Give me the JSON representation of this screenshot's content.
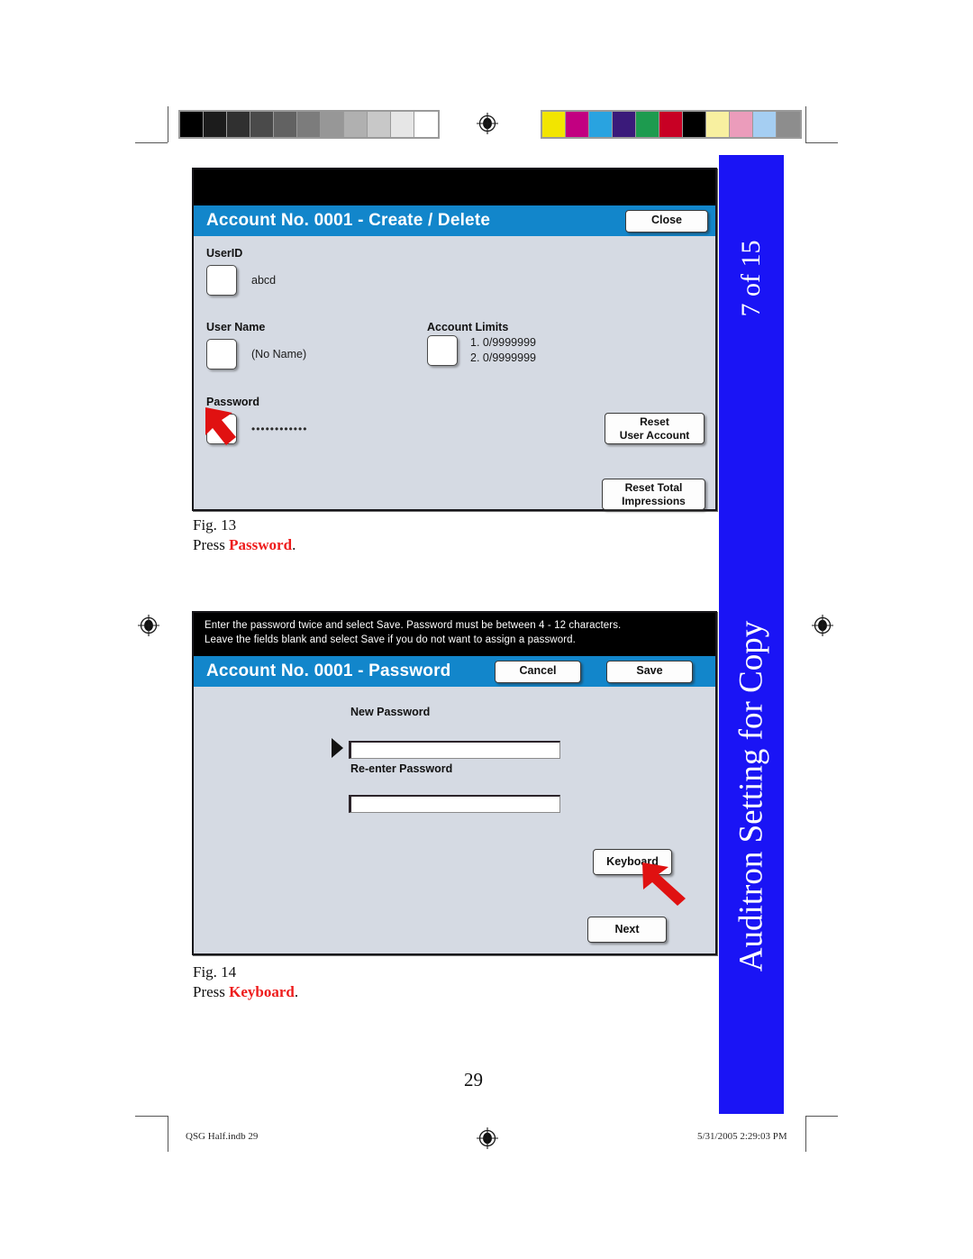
{
  "document": {
    "page_number": "29",
    "footer_left": "QSG Half.indb   29",
    "footer_right": "5/31/2005   2:29:03 PM"
  },
  "side_tab": {
    "page_indicator": "7 of 15",
    "section_title": "Auditron Setting for Copy",
    "color": "#1a14f5"
  },
  "calibration": {
    "grayscale": [
      "#000000",
      "#1c1c1c",
      "#303030",
      "#4a4a4a",
      "#626262",
      "#7c7c7c",
      "#979797",
      "#b0b0b0",
      "#c8c8c8",
      "#e6e6e6",
      "#ffffff"
    ],
    "colorbar": [
      "#f2e500",
      "#c20081",
      "#29a3e0",
      "#3a1a7a",
      "#1d9b4f",
      "#c80024",
      "#000000",
      "#f8f0a0",
      "#eb9cbb",
      "#a5cef2",
      "#8d8d8d"
    ]
  },
  "figure13": {
    "caption_line1": "Fig. 13",
    "caption_prefix": "Press ",
    "caption_highlight": "Password",
    "caption_suffix": ".",
    "panel": {
      "title": "Account No. 0001 - Create / Delete",
      "close_button": "Close",
      "userid_label": "UserID",
      "userid_value": "abcd",
      "username_label": "User Name",
      "username_value": "(No Name)",
      "account_limits_label": "Account Limits",
      "account_limits_line1": "1. 0/9999999",
      "account_limits_line2": "2. 0/9999999",
      "password_label": "Password",
      "password_value": "••••••••••••",
      "reset_user_account_button": "Reset\nUser Account",
      "reset_total_impressions_button": "Reset Total\nImpressions"
    }
  },
  "figure14": {
    "caption_line1": "Fig. 14",
    "caption_prefix": "Press ",
    "caption_highlight": "Keyboard",
    "caption_suffix": ".",
    "panel": {
      "instruction_line1": "Enter the password twice and select Save.  Password must be between 4 - 12 characters.",
      "instruction_line2": "Leave the fields blank and select Save if you do not want to assign a password.",
      "title": "Account No. 0001 - Password",
      "cancel_button": "Cancel",
      "save_button": "Save",
      "new_password_label": "New Password",
      "new_password_value": "",
      "reenter_password_label": "Re-enter Password",
      "reenter_password_value": "",
      "keyboard_button": "Keyboard",
      "next_button": "Next"
    }
  }
}
